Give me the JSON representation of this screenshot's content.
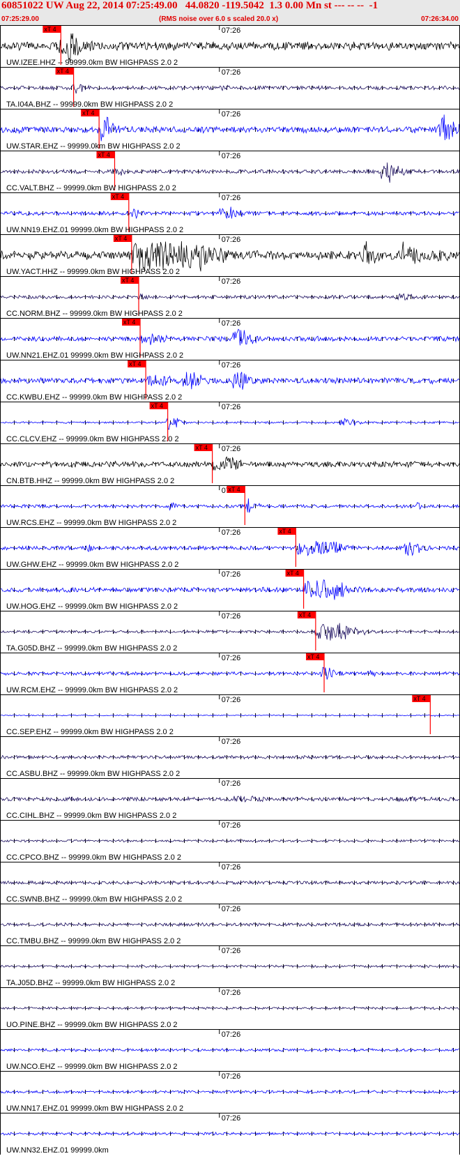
{
  "header": {
    "title": "60851022 UW Aug 22, 2014 07:25:49.00   44.0820 -119.5042  1.3 0.00 Mn st --- -- --  -1",
    "start_time": "07:25:29.00",
    "noise_note": "(RMS noise over 6.0 s scaled 20.0 x)",
    "end_time": "07:26:34.00"
  },
  "chart_data": {
    "type": "line",
    "title": "60851022 UW Aug 22, 2014 07:25:49.00   44.0820 -119.5042  1.3 0.00 Mn st --- -- --  -1",
    "x_start": "07:25:29.00",
    "x_end": "07:26:34.00",
    "minute_tick_label": "07:26",
    "pick_label": "xT 4",
    "colors": {
      "black": "#000000",
      "navy": "#1a0d5e",
      "blue": "#0000ff",
      "pick": "#ff0000"
    },
    "traces": [
      {
        "name": "UW.IZEE.HHZ -- 99999.0km BW  HIGHPASS  2.0  2",
        "color": "black",
        "pick_s": 8.6,
        "amp": 0.25,
        "bursts": [
          [
            8.5,
            5.0,
            3.0,
            1.0
          ]
        ]
      },
      {
        "name": "TA.I04A.BHZ -- 99999.0km BW  HIGHPASS  2.0  2",
        "color": "navy",
        "pick_s": 10.4,
        "amp": 0.12,
        "bursts": [
          [
            10.4,
            3.0,
            1.5,
            0.4
          ],
          [
            31.0,
            2.0,
            1.5,
            0.25
          ]
        ]
      },
      {
        "name": "UW.STAR.EHZ -- 99999.0km BW  HIGHPASS  2.0  2",
        "color": "blue",
        "pick_s": 14.0,
        "amp": 0.2,
        "bursts": [
          [
            14.0,
            4.0,
            2.0,
            0.8
          ],
          [
            33.0,
            1.5,
            1.0,
            0.3
          ],
          [
            62.0,
            3.0,
            2.0,
            1.0
          ]
        ]
      },
      {
        "name": "CC.VALT.BHZ -- 99999.0km BW  HIGHPASS  2.0  2",
        "color": "navy",
        "pick_s": 16.2,
        "amp": 0.12,
        "bursts": [
          [
            16.0,
            3.0,
            1.5,
            0.35
          ],
          [
            54.0,
            3.0,
            2.0,
            0.8
          ]
        ]
      },
      {
        "name": "UW.NN19.EHZ.01 99999.0km BW  HIGHPASS  2.0  2",
        "color": "blue",
        "pick_s": 18.2,
        "amp": 0.12,
        "bursts": [
          [
            18.5,
            2.5,
            1.5,
            0.35
          ],
          [
            31.0,
            6.0,
            3.0,
            0.4
          ]
        ]
      },
      {
        "name": "UW.YACT.HHZ -- 99999.0km BW  HIGHPASS  2.0  2",
        "color": "black",
        "pick_s": 18.6,
        "amp": 0.28,
        "bursts": [
          [
            18.7,
            40.0,
            3.0,
            1.0
          ],
          [
            30.0,
            6.0,
            2.0,
            0.6
          ],
          [
            51.0,
            5.0,
            2.0,
            0.8
          ],
          [
            57.0,
            5.0,
            2.0,
            0.9
          ],
          [
            62.0,
            3.0,
            1.5,
            0.5
          ]
        ]
      },
      {
        "name": "CC.NORM.BHZ -- 99999.0km BW  HIGHPASS  2.0  2",
        "color": "navy",
        "pick_s": 19.6,
        "amp": 0.1,
        "bursts": [
          [
            19.6,
            3.0,
            1.5,
            0.2
          ],
          [
            56.0,
            6.0,
            3.0,
            0.25
          ]
        ]
      },
      {
        "name": "UW.NN21.EHZ.01 99999.0km BW  HIGHPASS  2.0  2",
        "color": "blue",
        "pick_s": 19.8,
        "amp": 0.15,
        "bursts": [
          [
            20.0,
            6.0,
            3.0,
            0.4
          ],
          [
            33.0,
            4.0,
            2.0,
            0.75
          ]
        ]
      },
      {
        "name": "CC.KWBU.EHZ -- 99999.0km BW  HIGHPASS  2.0  2",
        "color": "blue",
        "pick_s": 20.6,
        "amp": 0.18,
        "bursts": [
          [
            21.0,
            5.0,
            3.0,
            0.5
          ],
          [
            26.0,
            4.0,
            2.0,
            0.65
          ],
          [
            33.0,
            4.0,
            2.0,
            0.7
          ]
        ]
      },
      {
        "name": "CC.CLCV.EHZ -- 99999.0km BW  HIGHPASS  2.0  2",
        "color": "blue",
        "pick_s": 23.7,
        "amp": 0.06,
        "bursts": [
          [
            23.7,
            3.0,
            1.0,
            0.5
          ],
          [
            48.0,
            5.0,
            2.0,
            0.3
          ]
        ]
      },
      {
        "name": "CN.BTB.HHZ -- 99999.0km BW  HIGHPASS  2.0  2",
        "color": "black",
        "pick_s": 30.0,
        "amp": 0.18,
        "bursts": [
          [
            30.0,
            15.0,
            1.0,
            0.45
          ]
        ]
      },
      {
        "name": "UW.RCS.EHZ -- 99999.0km BW  HIGHPASS  2.0  2",
        "color": "blue",
        "pick_s": 34.6,
        "amp": 0.1,
        "bursts": [
          [
            24.0,
            2.0,
            1.0,
            0.3
          ],
          [
            34.6,
            3.0,
            1.0,
            0.55
          ],
          [
            59.0,
            2.0,
            1.0,
            0.3
          ]
        ]
      },
      {
        "name": "UW.GHW.EHZ -- 99999.0km BW  HIGHPASS  2.0  2",
        "color": "blue",
        "pick_s": 41.8,
        "amp": 0.12,
        "bursts": [
          [
            12.0,
            2.0,
            1.0,
            0.25
          ],
          [
            41.8,
            20.0,
            3.0,
            0.5
          ],
          [
            57.0,
            5.0,
            2.0,
            0.55
          ]
        ]
      },
      {
        "name": "UW.HOG.EHZ -- 99999.0km BW  HIGHPASS  2.0  2",
        "color": "blue",
        "pick_s": 42.9,
        "amp": 0.15,
        "bursts": [
          [
            43.0,
            18.0,
            3.0,
            0.65
          ]
        ]
      },
      {
        "name": "TA.G05D.BHZ -- 99999.0km BW  HIGHPASS  2.0  2",
        "color": "navy",
        "pick_s": 44.6,
        "amp": 0.08,
        "bursts": [
          [
            44.6,
            14.0,
            3.0,
            0.6
          ]
        ]
      },
      {
        "name": "UW.RCM.EHZ -- 99999.0km BW  HIGHPASS  2.0  2",
        "color": "blue",
        "pick_s": 45.8,
        "amp": 0.1,
        "bursts": [
          [
            45.5,
            4.0,
            2.0,
            0.4
          ],
          [
            52.0,
            2.0,
            1.0,
            0.25
          ]
        ]
      },
      {
        "name": "CC.SEP.EHZ -- 99999.0km BW  HIGHPASS  2.0  2",
        "color": "blue",
        "pick_s": 60.8,
        "amp": 0.03,
        "bursts": [
          [
            60.8,
            2.0,
            1.0,
            0.08
          ]
        ]
      },
      {
        "name": "CC.ASBU.BHZ -- 99999.0km BW  HIGHPASS  2.0  2",
        "color": "navy",
        "pick_s": null,
        "amp": 0.1,
        "bursts": []
      },
      {
        "name": "CC.CIHL.BHZ -- 99999.0km BW  HIGHPASS  2.0  2",
        "color": "navy",
        "pick_s": null,
        "amp": 0.12,
        "bursts": [
          [
            9.0,
            5.0,
            3.0,
            0.15
          ],
          [
            33.0,
            15.0,
            5.0,
            0.2
          ],
          [
            56.0,
            10.0,
            5.0,
            0.15
          ]
        ]
      },
      {
        "name": "CC.CPCO.BHZ -- 99999.0km BW  HIGHPASS  2.0  2",
        "color": "navy",
        "pick_s": null,
        "amp": 0.07,
        "bursts": []
      },
      {
        "name": "CC.SWNB.BHZ -- 99999.0km BW  HIGHPASS  2.0  2",
        "color": "navy",
        "pick_s": null,
        "amp": 0.1,
        "bursts": [
          [
            32.0,
            8.0,
            4.0,
            0.08
          ]
        ]
      },
      {
        "name": "CC.TMBU.BHZ -- 99999.0km BW  HIGHPASS  2.0  2",
        "color": "navy",
        "pick_s": null,
        "amp": 0.1,
        "bursts": []
      },
      {
        "name": "TA.J05D.BHZ -- 99999.0km BW  HIGHPASS  2.0  2",
        "color": "navy",
        "pick_s": null,
        "amp": 0.07,
        "bursts": []
      },
      {
        "name": "UO.PINE.BHZ -- 99999.0km BW  HIGHPASS  2.0  2",
        "color": "navy",
        "pick_s": null,
        "amp": 0.07,
        "bursts": []
      },
      {
        "name": "UW.NCO.EHZ -- 99999.0km BW  HIGHPASS  2.0  2",
        "color": "blue",
        "pick_s": null,
        "amp": 0.08,
        "bursts": []
      },
      {
        "name": "UW.NN17.EHZ.01 99999.0km BW  HIGHPASS  2.0  2",
        "color": "blue",
        "pick_s": null,
        "amp": 0.08,
        "bursts": []
      },
      {
        "name": "UW.NN32.EHZ.01 99999.0km",
        "color": "blue",
        "pick_s": null,
        "amp": 0.08,
        "bursts": []
      }
    ]
  }
}
